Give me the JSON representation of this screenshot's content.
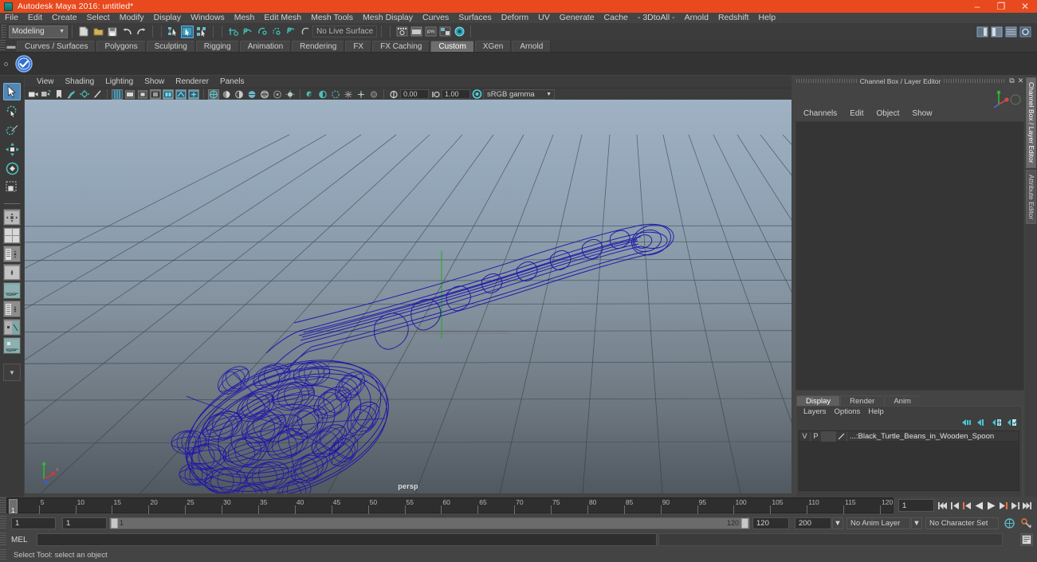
{
  "window": {
    "title": "Autodesk Maya 2016: untitled*",
    "app_icon": "maya-icon",
    "controls": [
      {
        "name": "minimize-button",
        "glyph": "–"
      },
      {
        "name": "restore-button",
        "glyph": "❐"
      },
      {
        "name": "close-button",
        "glyph": "✕"
      }
    ]
  },
  "menubar": {
    "items": [
      "File",
      "Edit",
      "Create",
      "Select",
      "Modify",
      "Display",
      "Windows",
      "Mesh",
      "Edit Mesh",
      "Mesh Tools",
      "Mesh Display",
      "Curves",
      "Surfaces",
      "Deform",
      "UV",
      "Generate",
      "Cache",
      "- 3DtoAll -",
      "Arnold",
      "Redshift",
      "Help"
    ]
  },
  "statusline": {
    "menu_set": "Modeling",
    "menu_set_caret": "▼",
    "live_surface": "No Live Surface",
    "file_icons": [
      "new-scene-icon",
      "open-scene-icon",
      "save-scene-icon",
      "undo-icon",
      "redo-icon"
    ],
    "select_mode_icons": [
      "select-by-hierarchy-icon",
      "select-by-object-type-icon",
      "select-by-component-type-icon"
    ],
    "snap_icons": [
      "snap-to-grid-icon",
      "snap-to-curve-icon",
      "snap-to-point-icon",
      "snap-to-projected-center-icon",
      "snap-to-view-plane-icon",
      "make-live-icon"
    ],
    "render_icons": [
      "render-current-frame-icon",
      "ipr-render-icon",
      "render-settings-icon",
      "hypershade-icon",
      "render-view-icon"
    ],
    "editor_icons": [
      "show-hide-attribute-editor-icon",
      "show-hide-tool-settings-icon",
      "show-hide-channel-box-icon",
      "show-hide-sidebar-icon"
    ]
  },
  "shelf": {
    "tabs": [
      {
        "label": "Curves / Surfaces",
        "active": false
      },
      {
        "label": "Polygons",
        "active": false
      },
      {
        "label": "Sculpting",
        "active": false
      },
      {
        "label": "Rigging",
        "active": false
      },
      {
        "label": "Animation",
        "active": false
      },
      {
        "label": "Rendering",
        "active": false
      },
      {
        "label": "FX",
        "active": false
      },
      {
        "label": "FX Caching",
        "active": false
      },
      {
        "label": "Custom",
        "active": true
      },
      {
        "label": "XGen",
        "active": false
      },
      {
        "label": "Arnold",
        "active": false
      }
    ],
    "buttons": [
      {
        "name": "shelf-item-checkmark",
        "icon": "blue-check-circle-icon"
      }
    ]
  },
  "toolbox": {
    "tools": [
      {
        "name": "select-tool",
        "icon": "arrow-cursor-icon",
        "selected": true
      },
      {
        "name": "lasso-select-tool",
        "icon": "lasso-icon",
        "selected": false
      },
      {
        "name": "paint-select-tool",
        "icon": "paint-brush-icon",
        "selected": false
      },
      {
        "name": "move-tool",
        "icon": "move-arrows-icon",
        "selected": false
      },
      {
        "name": "rotate-tool",
        "icon": "rotate-ring-icon",
        "selected": false
      },
      {
        "name": "scale-tool",
        "icon": "scale-box-icon",
        "selected": false
      }
    ],
    "layout_buttons": [
      {
        "name": "layout-single-perspective",
        "icon": "single-pane-icon"
      },
      {
        "name": "layout-four-view",
        "icon": "four-pane-icon"
      },
      {
        "name": "layout-persp-outliner",
        "icon": "two-pane-side-icon"
      },
      {
        "name": "layout-persp-graph",
        "icon": "two-pane-stacked-icon"
      },
      {
        "name": "layout-hypershade-persp",
        "icon": "three-pane-icon"
      },
      {
        "name": "layout-persp-uv",
        "icon": "uv-layout-icon"
      }
    ],
    "more_layouts": {
      "name": "layout-more-button",
      "glyph": "▼"
    }
  },
  "viewport": {
    "menus": [
      "View",
      "Shading",
      "Lighting",
      "Show",
      "Renderer",
      "Panels"
    ],
    "camera_label": "persp",
    "exposure": "0.00",
    "gamma": "1.00",
    "color_profile": "sRGB gamma",
    "color_profile_caret": "▼",
    "toolbar_icons": [
      "select-camera-icon",
      "camera-attributes-icon",
      "bookmark-icon",
      "image-plane-icon",
      "two-sided-lighting-icon",
      "view-gizmo-icon",
      "grid-toggle-icon",
      "film-gate-icon",
      "resolution-gate-icon",
      "gate-mask-icon",
      "xray-icon",
      "xray-joints-icon",
      "xray-active-components-icon",
      "wireframe-shading-icon",
      "smooth-shade-all-icon",
      "smooth-shade-selected-icon",
      "flat-shade-icon",
      "shaded-wireframe-icon",
      "textured-icon",
      "use-all-lights-icon",
      "shadows-icon",
      "screen-space-ao-icon",
      "motion-blur-icon",
      "multisample-aa-icon",
      "depth-of-field-icon",
      "isolate-select-icon",
      "exposure-icon",
      "gamma-icon",
      "view-transform-icon"
    ],
    "scene": {
      "object_name": "Black_Turtle_Beans_in_Wooden_Spoon",
      "wireframe_color": "#1f16a8",
      "grid_color": "#55606b",
      "background_top": "#9fb2c4",
      "background_bottom": "#505860"
    },
    "axis_gizmo": {
      "x_label": "x",
      "x_color": "#cc3a3a",
      "y_color": "#3fbf3f",
      "z_color": "#3a5fcc"
    }
  },
  "channelbox": {
    "panel_title": "Channel Box / Layer Editor",
    "window_buttons": [
      {
        "name": "undock-button",
        "glyph": "⧉"
      },
      {
        "name": "close-panel-button",
        "glyph": "✕"
      }
    ],
    "menus": [
      "Channels",
      "Edit",
      "Object",
      "Show"
    ],
    "channels": []
  },
  "layer_editor": {
    "tabs": [
      {
        "label": "Display",
        "active": true
      },
      {
        "label": "Render",
        "active": false
      },
      {
        "label": "Anim",
        "active": false
      }
    ],
    "menus": [
      "Layers",
      "Options",
      "Help"
    ],
    "buttons": [
      {
        "name": "move-layer-up-icon"
      },
      {
        "name": "move-layer-down-icon"
      },
      {
        "name": "create-empty-layer-icon"
      },
      {
        "name": "create-layer-from-selected-icon"
      }
    ],
    "columns": [
      "V",
      "P"
    ],
    "rows": [
      {
        "visible": "V",
        "playback": "P",
        "swatch": "layer-color-swatch",
        "name": "...:Black_Turtle_Beans_in_Wooden_Spoon"
      }
    ]
  },
  "side_tabs": [
    {
      "label": "Channel Box / Layer Editor",
      "active": true
    },
    {
      "label": "Attribute Editor",
      "active": false
    }
  ],
  "timeslider": {
    "start": 1,
    "end": 120,
    "current_frame": "1",
    "ticks": [
      1,
      5,
      10,
      15,
      20,
      25,
      30,
      35,
      40,
      45,
      50,
      55,
      60,
      65,
      70,
      75,
      80,
      85,
      90,
      95,
      100,
      105,
      110,
      115,
      120
    ],
    "playback_buttons": [
      {
        "name": "go-to-start-button",
        "glyph": "⏮"
      },
      {
        "name": "step-back-frame-button",
        "glyph": "⏴"
      },
      {
        "name": "step-back-key-button",
        "glyph": "⏴"
      },
      {
        "name": "play-backwards-button",
        "glyph": "◀"
      },
      {
        "name": "play-forwards-button",
        "glyph": "▶"
      },
      {
        "name": "step-forward-key-button",
        "glyph": "⏵"
      },
      {
        "name": "step-forward-frame-button",
        "glyph": "⏵"
      },
      {
        "name": "go-to-end-button",
        "glyph": "⏭"
      }
    ]
  },
  "rangeslider": {
    "anim_start": "1",
    "range_start": "1",
    "bar_start_label": "1",
    "bar_end_label": "120",
    "range_end": "120",
    "anim_end": "200",
    "anim_layer": "No Anim Layer",
    "character_set": "No Character Set",
    "caret": "▼",
    "icons": [
      "auto-keyframe-icon",
      "animation-preferences-icon"
    ]
  },
  "commandline": {
    "language": "MEL",
    "input_value": "",
    "output_value": "",
    "script_editor_icon": "script-editor-icon"
  },
  "helpline": {
    "text": "Select Tool: select an object"
  }
}
